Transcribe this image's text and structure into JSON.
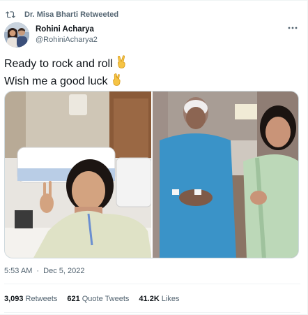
{
  "retweet": {
    "label": "Dr. Misa Bharti Retweeted",
    "icon": "retweet-icon"
  },
  "author": {
    "display_name": "Rohini Acharya",
    "handle": "@RohiniAcharya2",
    "avatar": "avatar"
  },
  "more_icon": "more-options-icon",
  "tweet": {
    "line1": "Ready to rock and roll",
    "line1_emoji": "victory-hand-emoji",
    "line2": "Wish me a good luck",
    "line2_emoji": "crossed-fingers-emoji"
  },
  "media": {
    "left_photo": "hospital-selfie-photo",
    "right_photo": "patient-with-daughter-photo"
  },
  "meta": {
    "time": "5:53 AM",
    "separator": "·",
    "date": "Dec 5, 2022"
  },
  "stats": {
    "retweets_count": "3,093",
    "retweets_label": "Retweets",
    "quotes_count": "621",
    "quotes_label": "Quote Tweets",
    "likes_count": "41.2K",
    "likes_label": "Likes"
  },
  "colors": {
    "text_primary": "#0f1419",
    "text_secondary": "#536471",
    "border": "#cfd9de",
    "divider": "#eff3f4"
  }
}
